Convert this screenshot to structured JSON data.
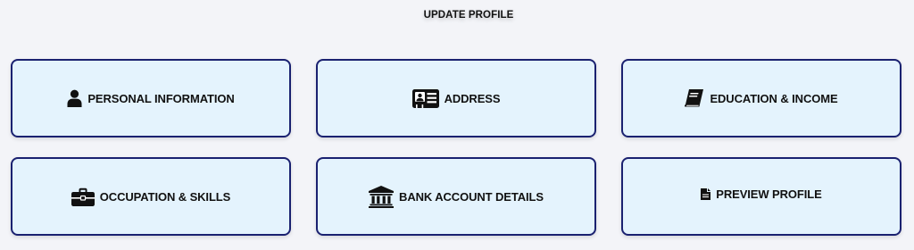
{
  "header": {
    "title": "UPDATE PROFILE"
  },
  "cards": [
    {
      "label": "PERSONAL INFORMATION",
      "icon": "user-icon"
    },
    {
      "label": "ADDRESS",
      "icon": "address-card-icon"
    },
    {
      "label": "EDUCATION & INCOME",
      "icon": "book-icon"
    },
    {
      "label": "OCCUPATION & SKILLS",
      "icon": "briefcase-icon"
    },
    {
      "label": "BANK ACCOUNT DETAILS",
      "icon": "bank-icon"
    },
    {
      "label": "PREVIEW PROFILE",
      "icon": "document-icon"
    }
  ],
  "colors": {
    "background": "#f3f4f8",
    "card_background": "#e4f3fd",
    "card_border": "#1a2170",
    "text": "#111111"
  }
}
